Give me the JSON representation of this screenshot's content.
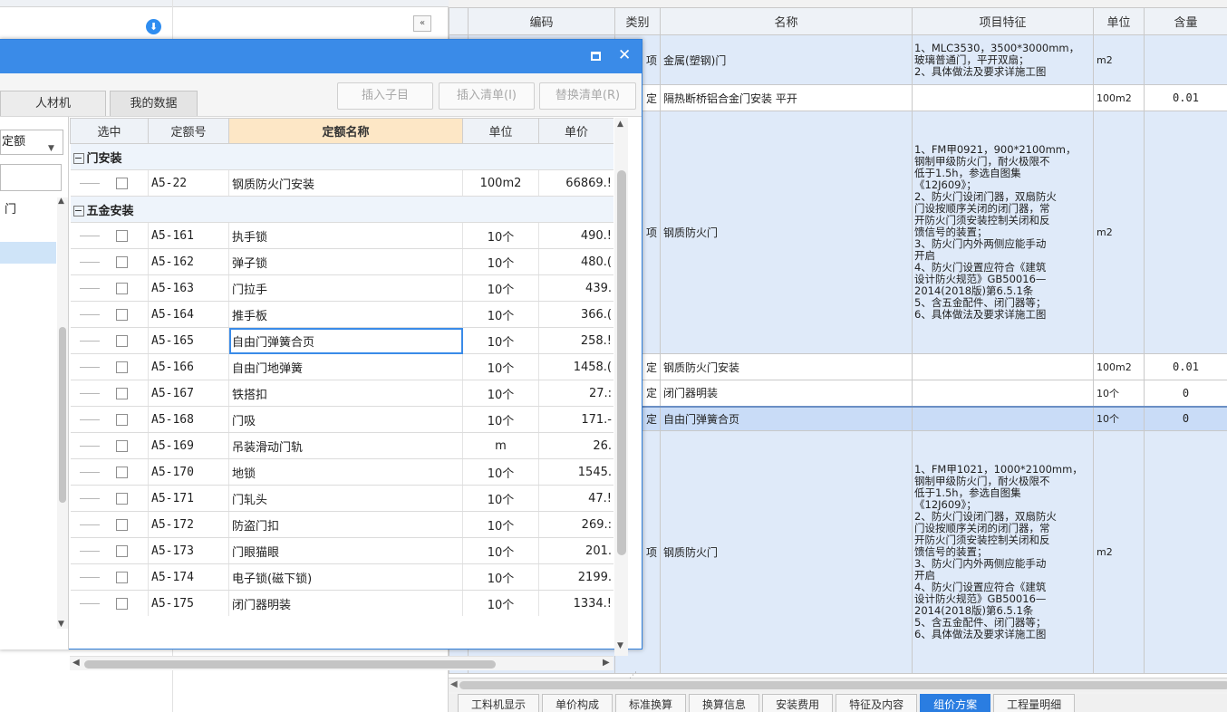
{
  "left_panel": {
    "download_icon": "download-icon",
    "collapse_label": "«"
  },
  "grid": {
    "headers": [
      "编码",
      "类别",
      "名称",
      "项目特征",
      "单位",
      "含量"
    ],
    "rows": [
      {
        "cls": "项",
        "name": "金属(塑钢)门",
        "feature": "1、MLC3530，3500*3000mm，\n玻璃普通门，平开双扇；\n2、具体做法及要求详施工图",
        "unit": "m2",
        "qty": ""
      },
      {
        "cls": "定",
        "name": "隔热断桥铝合金门安装 平开",
        "feature": "",
        "unit": "100m2",
        "qty": "0.01"
      },
      {
        "cls": "项",
        "name": "钢质防火门",
        "feature": "1、FM甲0921，900*2100mm，\n钢制甲级防火门，耐火极限不\n低于1.5h，参选自图集\n《12J609》；\n2、防火门设闭门器，双扇防火\n门设按顺序关闭的闭门器，常\n开防火门须安装控制关闭和反\n馈信号的装置；\n3、防火门内外两侧应能手动\n开启\n4、防火门设置应符合《建筑\n设计防火规范》GB50016—\n2014(2018版)第6.5.1条\n5、含五金配件、闭门器等；\n6、具体做法及要求详施工图",
        "unit": "m2",
        "qty": ""
      },
      {
        "cls": "定",
        "name": "钢质防火门安装",
        "feature": "",
        "unit": "100m2",
        "qty": "0.01"
      },
      {
        "cls": "定",
        "name": "闭门器明装",
        "feature": "",
        "unit": "10个",
        "qty": "0"
      },
      {
        "cls": "定",
        "name": "自由门弹簧合页",
        "feature": "",
        "unit": "10个",
        "qty": "0"
      },
      {
        "cls": "项",
        "name": "钢质防火门",
        "feature": "1、FM甲1021，1000*2100mm，\n钢制甲级防火门，耐火极限不\n低于1.5h，参选自图集\n《12J609》；\n2、防火门设闭门器，双扇防火\n门设按顺序关闭的闭门器，常\n开防火门须安装控制关闭和反\n馈信号的装置；\n3、防火门内外两侧应能手动\n开启\n4、防火门设置应符合《建筑\n设计防火规范》GB50016—\n2014(2018版)第6.5.1条\n5、含五金配件、闭门器等；\n6、具体做法及要求详施工图",
        "unit": "m2",
        "qty": ""
      }
    ]
  },
  "bottom_tabs": [
    {
      "label": "工料机显示",
      "active": false
    },
    {
      "label": "单价构成",
      "active": false
    },
    {
      "label": "标准换算",
      "active": false
    },
    {
      "label": "换算信息",
      "active": false
    },
    {
      "label": "安装费用",
      "active": false
    },
    {
      "label": "特征及内容",
      "active": false
    },
    {
      "label": "组价方案",
      "active": true
    },
    {
      "label": "工程量明细",
      "active": false
    }
  ],
  "dialog": {
    "tabs": [
      "人材机",
      "我的数据"
    ],
    "buttons": {
      "insert_child": "插入子目",
      "insert_list": "插入清单(I)",
      "replace_list": "替换清单(R)"
    },
    "combo_value": "定额",
    "tree_label": "门",
    "headers": {
      "select": "选中",
      "code": "定额号",
      "name": "定额名称",
      "unit": "单位",
      "price": "单价"
    },
    "groups": [
      {
        "title": "门安装",
        "expand": "−",
        "items": [
          {
            "code": "A5-22",
            "name": "钢质防火门安装",
            "unit": "100m2",
            "price": "66869.!"
          }
        ]
      },
      {
        "title": "五金安装",
        "expand": "−",
        "items": [
          {
            "code": "A5-161",
            "name": "执手锁",
            "unit": "10个",
            "price": "490.!"
          },
          {
            "code": "A5-162",
            "name": "弹子锁",
            "unit": "10个",
            "price": "480.("
          },
          {
            "code": "A5-163",
            "name": "门拉手",
            "unit": "10个",
            "price": "439."
          },
          {
            "code": "A5-164",
            "name": "推手板",
            "unit": "10个",
            "price": "366.("
          },
          {
            "code": "A5-165",
            "name": "自由门弹簧合页",
            "unit": "10个",
            "price": "258.!"
          },
          {
            "code": "A5-166",
            "name": "自由门地弹簧",
            "unit": "10个",
            "price": "1458.("
          },
          {
            "code": "A5-167",
            "name": "铁搭扣",
            "unit": "10个",
            "price": "27.:"
          },
          {
            "code": "A5-168",
            "name": "门吸",
            "unit": "10个",
            "price": "171.-"
          },
          {
            "code": "A5-169",
            "name": "吊装滑动门轨",
            "unit": "m",
            "price": "26."
          },
          {
            "code": "A5-170",
            "name": "地锁",
            "unit": "10个",
            "price": "1545."
          },
          {
            "code": "A5-171",
            "name": "门轧头",
            "unit": "10个",
            "price": "47.!"
          },
          {
            "code": "A5-172",
            "name": "防盗门扣",
            "unit": "10个",
            "price": "269.:"
          },
          {
            "code": "A5-173",
            "name": "门眼猫眼",
            "unit": "10个",
            "price": "201."
          },
          {
            "code": "A5-174",
            "name": "电子锁(磁下锁)",
            "unit": "10个",
            "price": "2199."
          },
          {
            "code": "A5-175",
            "name": "闭门器明装",
            "unit": "10个",
            "price": "1334.!"
          }
        ]
      }
    ]
  },
  "colors": {
    "title_bar": "#3a8be8",
    "active_tab": "#2a7de1",
    "row_blue": "#dfeaf9",
    "header_highlight": "#fde7c6"
  }
}
